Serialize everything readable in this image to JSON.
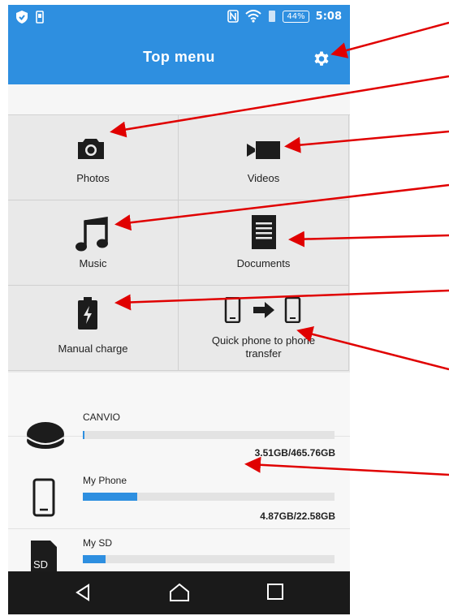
{
  "status_bar": {
    "icons_left": [
      "shield-icon",
      "phone-outline-icon"
    ],
    "icons_right": [
      "nfc-icon",
      "wifi-icon",
      "sim-icon"
    ],
    "battery": "44%",
    "time": "5:08"
  },
  "app_bar": {
    "title": "Top menu",
    "settings_icon": "gear-icon"
  },
  "menu": {
    "photos": "Photos",
    "videos": "Videos",
    "music": "Music",
    "documents": "Documents",
    "manual_charge": "Manual charge",
    "transfer": "Quick phone to phone transfer"
  },
  "storage": [
    {
      "name": "CANVIO",
      "size": "3.51GB/465.76GB",
      "used_fraction": 0.0075
    },
    {
      "name": "My Phone",
      "size": "4.87GB/22.58GB",
      "used_fraction": 0.2157
    },
    {
      "name": "My SD",
      "size": "",
      "used_fraction": 0.09
    }
  ],
  "nav": [
    "back-icon",
    "home-icon",
    "recents-icon"
  ],
  "colors": {
    "accent": "#2e8fe0",
    "arrow": "#e00000",
    "nav": "#1a1a1a"
  }
}
